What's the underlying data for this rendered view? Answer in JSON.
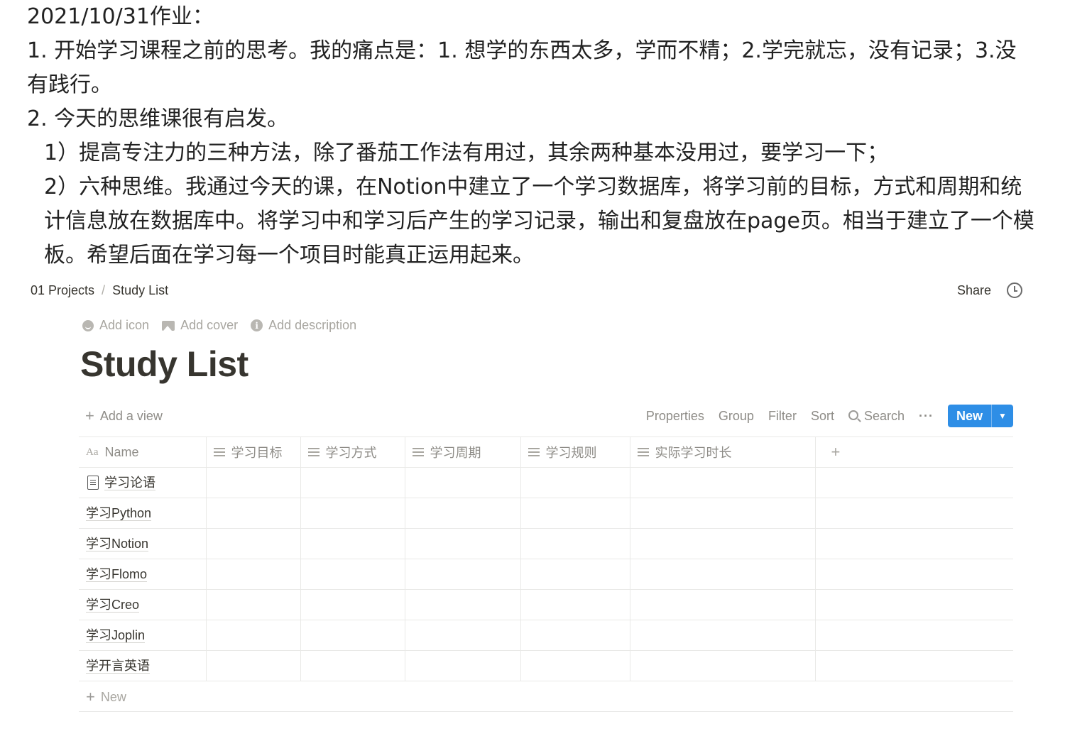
{
  "note": {
    "title": "2021/10/31作业：",
    "para1": "1. 开始学习课程之前的思考。我的痛点是：1. 想学的东西太多，学而不精；2.学完就忘，没有记录；3.没有践行。",
    "para2": "2. 今天的思维课很有启发。",
    "para3": "1）提高专注力的三种方法，除了番茄工作法有用过，其余两种基本没用过，要学习一下；",
    "para4": "2）六种思维。我通过今天的课，在Notion中建立了一个学习数据库，将学习前的目标，方式和周期和统计信息放在数据库中。将学习中和学习后产生的学习记录，输出和复盘放在page页。相当于建立了一个模板。希望后面在学习每一个项目时能真正运用起来。"
  },
  "topbar": {
    "crumb1": "01 Projects",
    "sep": "/",
    "crumb2": "Study List",
    "share": "Share"
  },
  "page_controls": {
    "add_icon": "Add icon",
    "add_cover": "Add cover",
    "add_description": "Add description"
  },
  "page_title": "Study List",
  "viewbar": {
    "add_view": "Add a view",
    "properties": "Properties",
    "group": "Group",
    "filter": "Filter",
    "sort": "Sort",
    "search": "Search",
    "more": "···",
    "new": "New"
  },
  "table": {
    "headers": {
      "name_icon": "Aa",
      "name": "Name",
      "c1": "学习目标",
      "c2": "学习方式",
      "c3": "学习周期",
      "c4": "学习规则",
      "c5": "实际学习时长",
      "add": "+"
    },
    "rows": [
      "学习论语",
      "学习Python",
      "学习Notion",
      "学习Flomo",
      "学习Creo",
      "学习Joplin",
      "学开言英语"
    ]
  },
  "new_row": "New",
  "colors": {
    "accent": "#2e8ee6",
    "text": "#37352f",
    "muted": "#8e8c87",
    "border": "#e9e9e7"
  }
}
